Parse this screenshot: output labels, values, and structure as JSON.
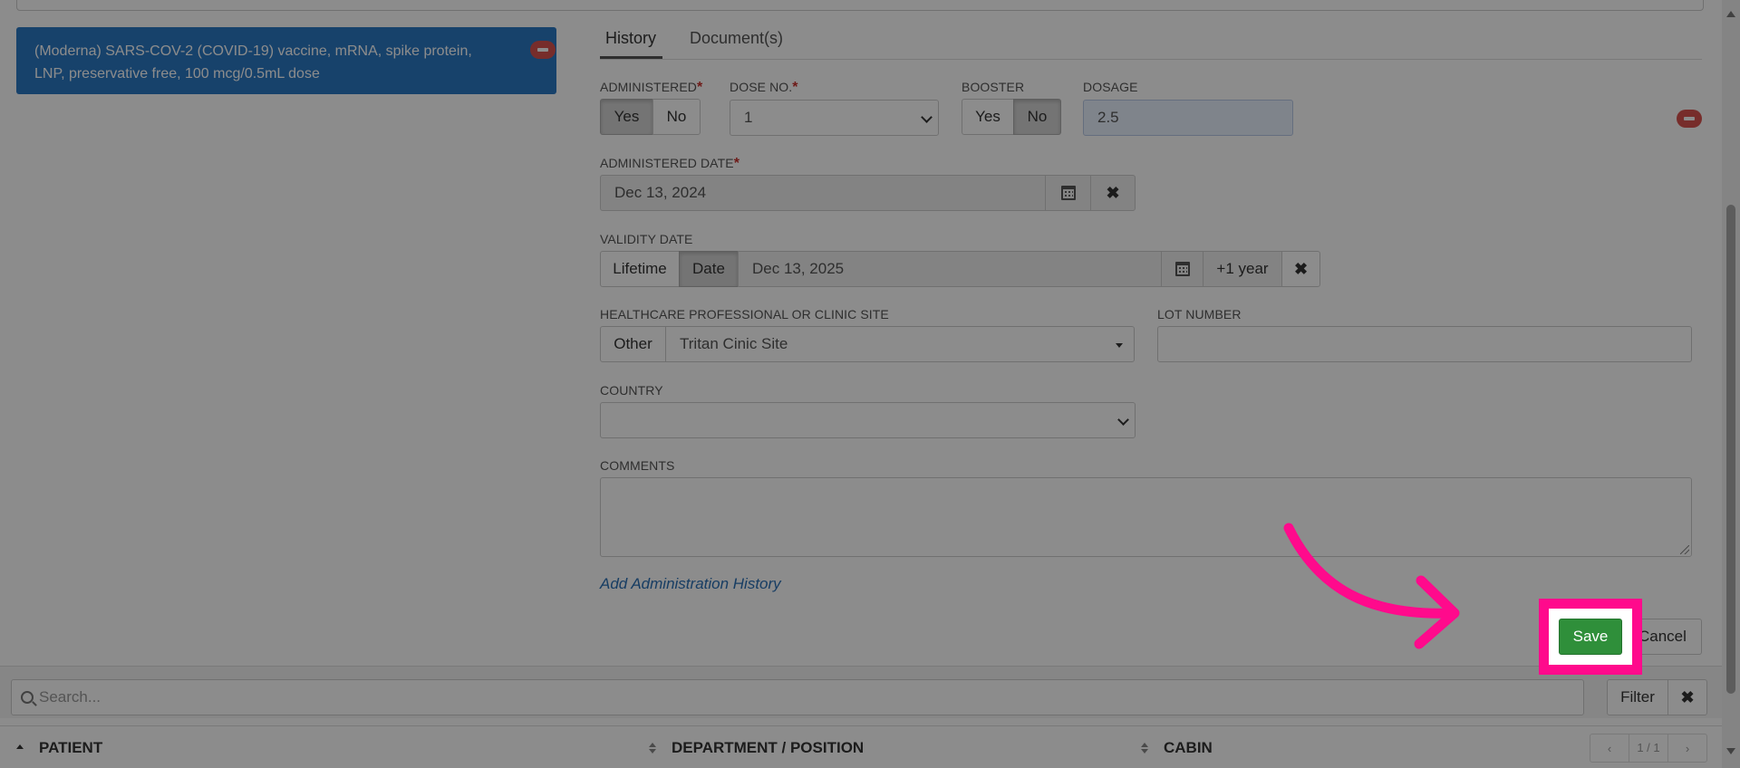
{
  "vaccine_card": {
    "text": "(Moderna) SARS-COV-2 (COVID-19) vaccine, mRNA, spike protein, LNP, preservative free, 100 mcg/0.5mL dose"
  },
  "tabs": [
    {
      "label": "History"
    },
    {
      "label": "Document(s)"
    }
  ],
  "form": {
    "administered": {
      "label": "ADMINISTERED",
      "required_mark": "*",
      "options": [
        "Yes",
        "No"
      ],
      "selected": "Yes"
    },
    "dose_no": {
      "label": "DOSE NO.",
      "required_mark": "*",
      "value": "1"
    },
    "booster": {
      "label": "BOOSTER",
      "options": [
        "Yes",
        "No"
      ],
      "selected": "No"
    },
    "dosage": {
      "label": "DOSAGE",
      "value": "2.5"
    },
    "administered_date": {
      "label": "ADMINISTERED DATE",
      "required_mark": "*",
      "value": "Dec 13, 2024"
    },
    "validity_date": {
      "label": "VALIDITY DATE",
      "options": [
        "Lifetime",
        "Date"
      ],
      "selected": "Date",
      "value": "Dec 13, 2025",
      "plus_year_label": "+1 year"
    },
    "healthcare": {
      "label": "HEALTHCARE PROFESSIONAL OR CLINIC SITE",
      "other_label": "Other",
      "value": "Tritan Cinic Site"
    },
    "lot_number": {
      "label": "LOT NUMBER",
      "value": ""
    },
    "country": {
      "label": "COUNTRY",
      "value": ""
    },
    "comments": {
      "label": "COMMENTS",
      "value": ""
    },
    "add_history_link": "Add Administration History"
  },
  "actions": {
    "save_label": "Save",
    "cancel_label": "Cancel"
  },
  "search": {
    "placeholder": "Search...",
    "filter_label": "Filter"
  },
  "table": {
    "columns": [
      "PATIENT",
      "DEPARTMENT / POSITION",
      "CABIN"
    ],
    "pager": "1 / 1"
  },
  "icons": {
    "remove": "minus-circle-icon",
    "calendar": "calendar-icon",
    "clear": "close-icon",
    "search": "search-icon",
    "annotation_arrow": "curved-arrow-icon"
  },
  "colors": {
    "card_blue": "#2b78c4",
    "save_green": "#2f8f3a",
    "highlight_pink": "#ff0a8c",
    "remove_red": "#d9534f",
    "link_blue": "#2a6fb5"
  }
}
